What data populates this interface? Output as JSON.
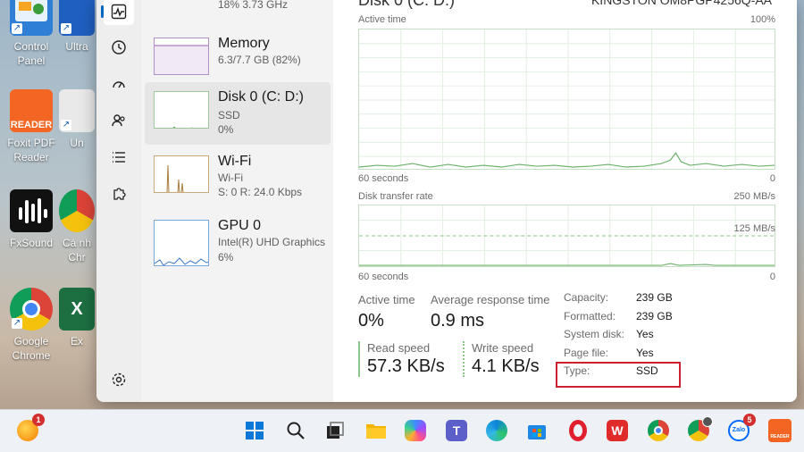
{
  "desktop": {
    "icons": [
      {
        "label": "Control Panel"
      },
      {
        "label": "Ultra"
      },
      {
        "label": "Foxit PDF Reader"
      },
      {
        "label": "Un"
      },
      {
        "label": "FxSound"
      },
      {
        "label": "Cá nh Chr"
      },
      {
        "label": "Google Chrome"
      },
      {
        "label": "Ex"
      }
    ],
    "foxit_tile_text": "READER",
    "excel_tile_text": "X"
  },
  "perf_list": {
    "cpu_cut": "18%  3.73 GHz",
    "memory": {
      "name": "Memory",
      "detail": "6.3/7.7 GB (82%)"
    },
    "disk": {
      "name": "Disk 0 (C: D:)",
      "type": "SSD",
      "usage": "0%"
    },
    "wifi": {
      "name": "Wi-Fi",
      "adapter": "Wi-Fi",
      "rate": "S: 0  R: 24.0 Kbps"
    },
    "gpu": {
      "name": "GPU 0",
      "model": "Intel(R) UHD Graphics",
      "usage": "6%"
    }
  },
  "detail": {
    "header_left_cut": "Disk 0 (C: D:)",
    "header_right_cut": "KINGSTON OM8PGP4256Q-AA",
    "active_time_graph": {
      "title": "Active time",
      "max": "100%",
      "span": "60 seconds",
      "min": "0"
    },
    "transfer_graph": {
      "title": "Disk transfer rate",
      "max": "250 MB/s",
      "mid": "125 MB/s",
      "span": "60 seconds",
      "min": "0"
    },
    "active_time": {
      "label": "Active time",
      "value": "0%"
    },
    "avg_response": {
      "label": "Average response time",
      "value": "0.9 ms"
    },
    "read_speed": {
      "label": "Read speed",
      "value": "57.3 KB/s"
    },
    "write_speed": {
      "label": "Write speed",
      "value": "4.1 KB/s"
    },
    "props": [
      {
        "k": "Capacity:",
        "v": "239 GB"
      },
      {
        "k": "Formatted:",
        "v": "239 GB"
      },
      {
        "k": "System disk:",
        "v": "Yes"
      },
      {
        "k": "Page file:",
        "v": "Yes"
      },
      {
        "k": "Type:",
        "v": "SSD"
      }
    ]
  },
  "taskbar": {
    "notif_badge": "1",
    "zalo_badge": "5",
    "zalo_label": "Zalo",
    "reader_label": "READER"
  },
  "colors": {
    "accent": "#0067c0",
    "graph_line": "#8cc68b",
    "highlight": "#d01f2e"
  }
}
